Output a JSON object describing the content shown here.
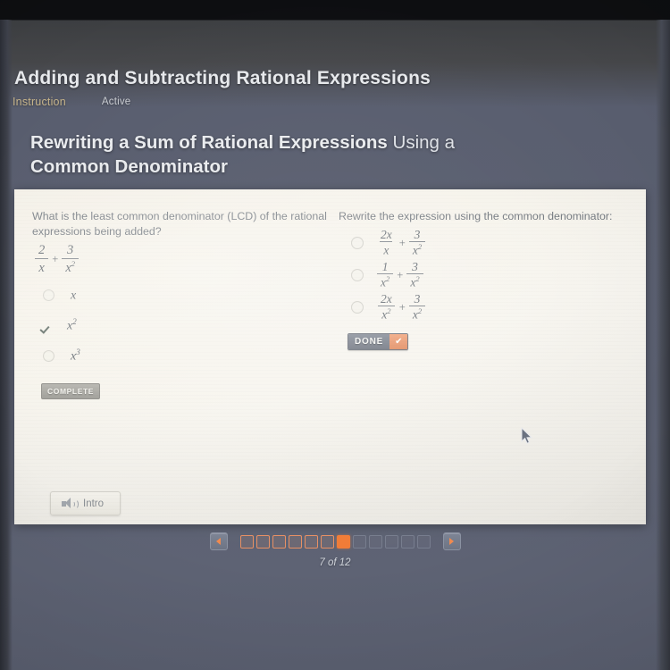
{
  "header": {
    "course_title": "Adding and Subtracting Rational Expressions",
    "tab_instruction": "Instruction",
    "tab_active": "Active",
    "lesson_title_line1": "Rewriting a Sum of Rational Expressions",
    "lesson_title_line1_tail": " Using a",
    "lesson_title_line2": "Common Denominator"
  },
  "left_panel": {
    "question": "What is the least common denominator (LCD) of the rational expressions being added?",
    "expression": {
      "term1": {
        "numerator": "2",
        "denominator": "x",
        "denominator_exp": ""
      },
      "operator": "+",
      "term2": {
        "numerator": "3",
        "denominator": "x",
        "denominator_exp": "2"
      }
    },
    "options": [
      {
        "label": "x",
        "exponent": "",
        "state": "unselected"
      },
      {
        "label": "x",
        "exponent": "2",
        "state": "correct"
      },
      {
        "label": "x",
        "exponent": "3",
        "state": "unselected"
      }
    ],
    "status_badge": "COMPLETE"
  },
  "right_panel": {
    "question": "Rewrite the expression using the common denominator:",
    "options": [
      {
        "state": "unselected",
        "term1": {
          "numerator": "2x",
          "denominator": "x",
          "denominator_exp": ""
        },
        "operator": "+",
        "term2": {
          "numerator": "3",
          "denominator": "x",
          "denominator_exp": "2"
        }
      },
      {
        "state": "unselected",
        "term1": {
          "numerator": "1",
          "denominator": "x",
          "denominator_exp": "2"
        },
        "operator": "+",
        "term2": {
          "numerator": "3",
          "denominator": "x",
          "denominator_exp": "2"
        }
      },
      {
        "state": "unselected",
        "term1": {
          "numerator": "2x",
          "denominator": "x",
          "denominator_exp": "2"
        },
        "operator": "+",
        "term2": {
          "numerator": "3",
          "denominator": "x",
          "denominator_exp": "2"
        }
      }
    ],
    "done_label": "DONE",
    "done_check": "✔"
  },
  "audio_button": {
    "label": "Intro",
    "icon": "speaker-icon"
  },
  "pagination": {
    "prev_icon": "triangle-left-icon",
    "next_icon": "triangle-right-icon",
    "total": 12,
    "current": 7,
    "counter_text": "7 of 12",
    "states": [
      "visited",
      "visited",
      "visited",
      "visited",
      "visited",
      "visited",
      "current",
      "upcoming",
      "upcoming",
      "upcoming",
      "upcoming",
      "upcoming"
    ]
  },
  "colors": {
    "accent_orange": "#f07c37",
    "visited_outline": "#e79064",
    "tab_instruction": "#c6b48a",
    "card_background": "#f6f3ea",
    "page_background": "#5a5f70",
    "done_check_bg": "#e18a5e"
  }
}
